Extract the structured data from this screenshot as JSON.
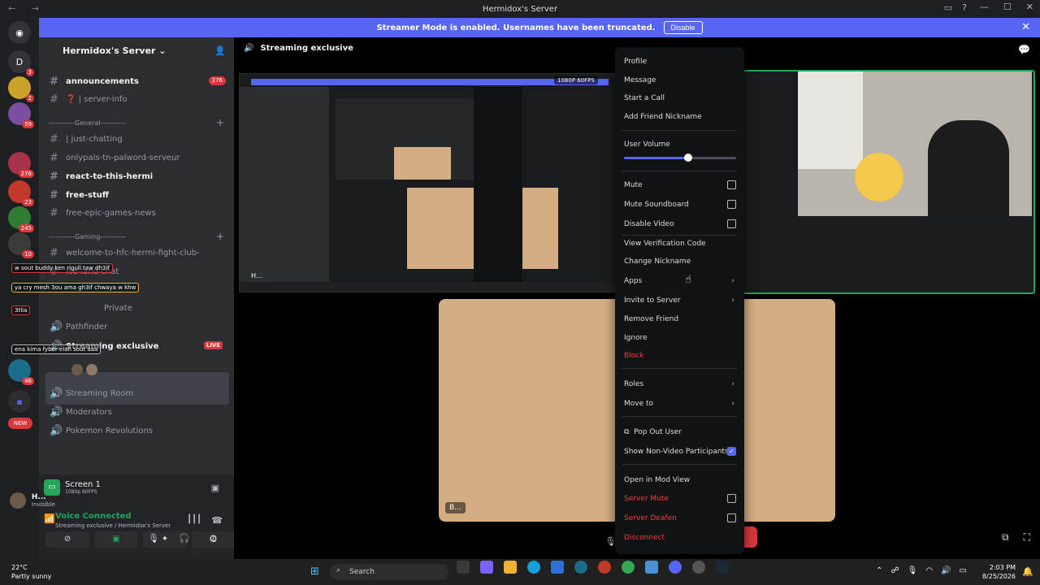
{
  "window": {
    "title": "Hermidox's Server",
    "nav_arrows": "← →",
    "controls": [
      "—",
      "☐",
      "✕"
    ]
  },
  "banner": {
    "message": "Streamer Mode is enabled. Usernames have been truncated.",
    "button": "Disable"
  },
  "server_rail": [
    {
      "label": "D",
      "color": "#313338",
      "badge": "3"
    },
    {
      "label": "",
      "color": "#c9a227",
      "badge": "2"
    },
    {
      "label": "",
      "color": "#7a4ea0",
      "badge": "59"
    },
    {
      "label": "",
      "color": "#a8324a",
      "badge": "276"
    },
    {
      "label": "",
      "color": "#c0392b",
      "badge": "23"
    },
    {
      "label": "",
      "color": "#2e7d32",
      "badge": "245"
    },
    {
      "label": "",
      "color": "#3b3b3b",
      "badge": "10"
    },
    {
      "label": "",
      "color": "#1c6b8a",
      "badge": "46"
    }
  ],
  "sidebar": {
    "server_name": "Hermidox's Server",
    "channels": [
      {
        "name": "announcements",
        "icon": "#",
        "bold": true,
        "badge": "276"
      },
      {
        "name": "❓ | server-info",
        "icon": "#",
        "bold": false
      },
      {
        "name": "-----------General-----------",
        "category": true
      },
      {
        "name": "| just-chatting",
        "icon": "#",
        "bold": false
      },
      {
        "name": "onlypals-tn-palword-serveur",
        "icon": "#",
        "bold": false
      },
      {
        "name": "react-to-this-hermi",
        "icon": "#",
        "bold": true
      },
      {
        "name": "free-stuff",
        "icon": "#",
        "bold": true
      },
      {
        "name": "free-epic-games-news",
        "icon": "#",
        "bold": false
      },
      {
        "name": "-----------Gaming-----------",
        "category": true
      },
      {
        "name": "welcome-to-hfc-hermi-fight-club-",
        "icon": "#",
        "bold": false
      },
      {
        "name": "Ice-land-chat",
        "icon": "#",
        "bold": false
      },
      {
        "name": "Private",
        "icon": "🔊",
        "bold": false
      },
      {
        "name": "Pathfinder",
        "icon": "🔊",
        "bold": false
      },
      {
        "name": "Streaming exclusive",
        "icon": "🔊",
        "bold": true,
        "live": "LIVE"
      },
      {
        "name": "Streaming Room",
        "icon": "🔊",
        "bold": false
      },
      {
        "name": "Moderators",
        "icon": "🔊",
        "bold": false
      },
      {
        "name": "Pokemon Revolutions",
        "icon": "🔊",
        "bold": false
      }
    ],
    "overlay_tags": [
      "w sout buddy ken rigull taw dh3if",
      "ya cry mesh 3ou ama gh3if chwaya w khw",
      "3tlia",
      "ena kima fyber elah sout aaa"
    ]
  },
  "user_panel": {
    "screen_title": "Screen 1",
    "screen_sub": "1080p 60FPS",
    "voice_status": "Voice Connected",
    "voice_channel": "Streaming exclusive / Hermidox's Server",
    "username": "H...",
    "user_status": "Invisible"
  },
  "main": {
    "channel_title": "Streaming exclusive",
    "fps_badge": "1080P 60FPS",
    "stream_label": "H...",
    "big_label": "B..."
  },
  "context_menu": {
    "items_top": [
      "Profile",
      "Message",
      "Start a Call",
      "Add Friend Nickname"
    ],
    "volume_label": "User Volume",
    "volume_fraction": 0.57,
    "toggles": [
      {
        "label": "Mute",
        "checked": false
      },
      {
        "label": "Mute Soundboard",
        "checked": false
      },
      {
        "label": "Disable Video",
        "checked": false
      }
    ],
    "items_mid": [
      "View Verification Code",
      "Change Nickname"
    ],
    "submenus": [
      "Apps",
      "Invite to Server"
    ],
    "items_low": [
      "Remove Friend",
      "Ignore"
    ],
    "block": "Block",
    "roles": "Roles",
    "move_to": "Move to",
    "pop_out": "Pop Out User",
    "show_non_video": "Show Non-Video Participants",
    "show_non_video_checked": true,
    "open_mod": "Open in Mod View",
    "server_mute": "Server Mute",
    "server_deafen": "Server Deafen",
    "disconnect": "Disconnect"
  },
  "taskbar": {
    "weather_temp": "22°C",
    "weather_desc": "Partly sunny",
    "search": "Search",
    "time": "2:03 PM",
    "date": "8/25/2026"
  }
}
